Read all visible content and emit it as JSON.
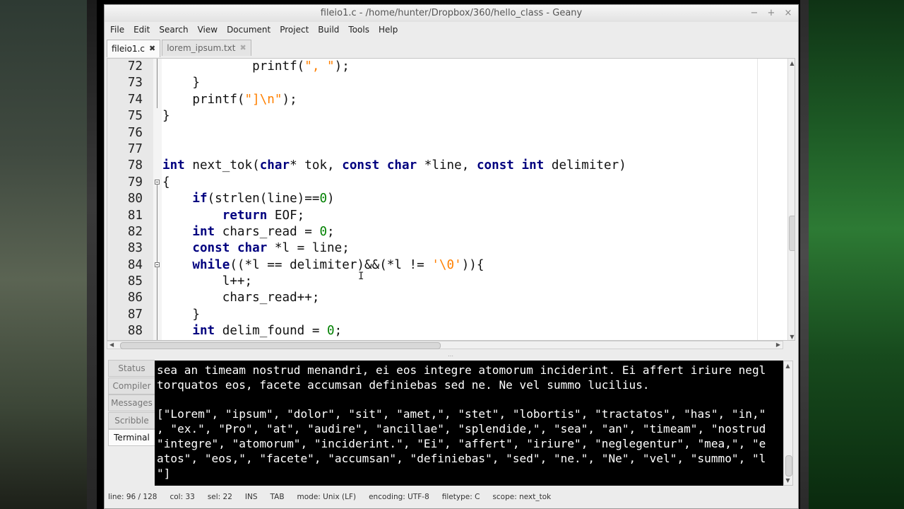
{
  "window": {
    "title": "fileio1.c - /home/hunter/Dropbox/360/hello_class - Geany"
  },
  "menu": [
    "File",
    "Edit",
    "Search",
    "View",
    "Document",
    "Project",
    "Build",
    "Tools",
    "Help"
  ],
  "tabs": [
    {
      "label": "fileio1.c",
      "active": true
    },
    {
      "label": "lorem_ipsum.txt",
      "active": false
    }
  ],
  "editor": {
    "lines": [
      {
        "n": "72",
        "text": "            printf(\", \");"
      },
      {
        "n": "73",
        "text": "    }"
      },
      {
        "n": "74",
        "text": "    printf(\"]\\n\");"
      },
      {
        "n": "75",
        "text": "}"
      },
      {
        "n": "76",
        "text": ""
      },
      {
        "n": "77",
        "text": ""
      },
      {
        "n": "78",
        "text": "int next_tok(char* tok, const char *line, const int delimiter)"
      },
      {
        "n": "79",
        "text": "{"
      },
      {
        "n": "80",
        "text": "    if(strlen(line)==0)"
      },
      {
        "n": "81",
        "text": "        return EOF;"
      },
      {
        "n": "82",
        "text": "    int chars_read = 0;"
      },
      {
        "n": "83",
        "text": "    const char *l = line;"
      },
      {
        "n": "84",
        "text": "    while((*l == delimiter)&&(*l != '\\0')){"
      },
      {
        "n": "85",
        "text": "        l++;"
      },
      {
        "n": "86",
        "text": "        chars_read++;"
      },
      {
        "n": "87",
        "text": "    }"
      },
      {
        "n": "88",
        "text": "    int delim_found = 0;"
      }
    ]
  },
  "message_tabs": [
    "Status",
    "Compiler",
    "Messages",
    "Scribble",
    "Terminal"
  ],
  "active_message_tab": "Terminal",
  "terminal": {
    "lines": [
      "sea an timeam nostrud menandri, ei eos integre atomorum inciderint. Ei affert iriure negl",
      "torquatos eos, facete accumsan definiebas sed ne. Ne vel summo lucilius.",
      "",
      "[\"Lorem\", \"ipsum\", \"dolor\", \"sit\", \"amet,\", \"stet\", \"lobortis\", \"tractatos\", \"has\", \"in,\"",
      ", \"ex.\", \"Pro\", \"at\", \"audire\", \"ancillae\", \"splendide,\", \"sea\", \"an\", \"timeam\", \"nostrud",
      "\"integre\", \"atomorum\", \"inciderint.\", \"Ei\", \"affert\", \"iriure\", \"neglegentur\", \"mea,\", \"e",
      "atos\", \"eos,\", \"facete\", \"accumsan\", \"definiebas\", \"sed\", \"ne.\", \"Ne\", \"vel\", \"summo\", \"l",
      "\"]"
    ]
  },
  "statusbar": {
    "line": "line: 96 / 128",
    "col": "col: 33",
    "sel": "sel: 22",
    "ins": "INS",
    "tab": "TAB",
    "mode": "mode: Unix (LF)",
    "encoding": "encoding: UTF-8",
    "filetype": "filetype: C",
    "scope": "scope: next_tok"
  },
  "colors": {
    "keyword": "#00007f",
    "string": "#ff8000",
    "number": "#008000"
  }
}
